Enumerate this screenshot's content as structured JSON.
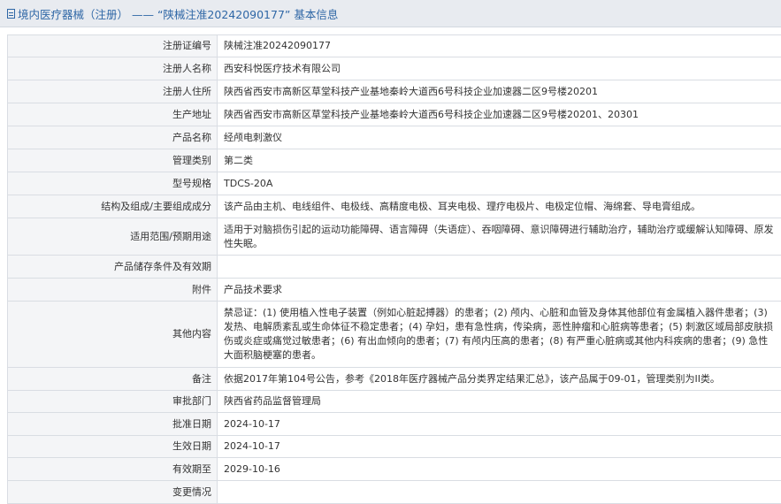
{
  "header": {
    "title": "境内医疗器械（注册） —— “陕械注准20242090177” 基本信息"
  },
  "rows": [
    {
      "label": "注册证编号",
      "value": "陕械注准20242090177"
    },
    {
      "label": "注册人名称",
      "value": "西安科悦医疗技术有限公司"
    },
    {
      "label": "注册人住所",
      "value": "陕西省西安市高新区草堂科技产业基地秦岭大道西6号科技企业加速器二区9号楼20201"
    },
    {
      "label": "生产地址",
      "value": "陕西省西安市高新区草堂科技产业基地秦岭大道西6号科技企业加速器二区9号楼20201、20301"
    },
    {
      "label": "产品名称",
      "value": "经颅电刺激仪"
    },
    {
      "label": "管理类别",
      "value": "第二类"
    },
    {
      "label": "型号规格",
      "value": "TDCS-20A"
    },
    {
      "label": "结构及组成/主要组成成分",
      "value": "该产品由主机、电线组件、电极线、高精度电极、耳夹电极、理疗电极片、电极定位帽、海绵套、导电膏组成。"
    },
    {
      "label": "适用范围/预期用途",
      "value": "适用于对脑损伤引起的运动功能障碍、语言障碍（失语症）、吞咽障碍、意识障碍进行辅助治疗，辅助治疗或缓解认知障碍、原发性失眠。"
    },
    {
      "label": "产品储存条件及有效期",
      "value": ""
    },
    {
      "label": "附件",
      "value": "产品技术要求"
    },
    {
      "label": "其他内容",
      "value": "禁忌证：(1) 使用植入性电子装置（例如心脏起搏器）的患者；(2) 颅内、心脏和血管及身体其他部位有金属植入器件患者；(3) 发热、电解质紊乱或生命体征不稳定患者；(4) 孕妇，患有急性病，传染病，恶性肿瘤和心脏病等患者；(5) 刺激区域局部皮肤损伤或炎症或痛觉过敏患者；(6) 有出血倾向的患者；(7) 有颅内压高的患者；(8) 有严重心脏病或其他内科疾病的患者；(9) 急性大面积脑梗塞的患者。"
    },
    {
      "label": "备注",
      "value": "依据2017年第104号公告，参考《2018年医疗器械产品分类界定结果汇总》，该产品属于09-01，管理类别为II类。"
    },
    {
      "label": "审批部门",
      "value": "陕西省药品监督管理局"
    },
    {
      "label": "批准日期",
      "value": "2024-10-17"
    },
    {
      "label": "生效日期",
      "value": "2024-10-17"
    },
    {
      "label": "有效期至",
      "value": "2029-10-16"
    },
    {
      "label": "变更情况",
      "value": ""
    }
  ]
}
